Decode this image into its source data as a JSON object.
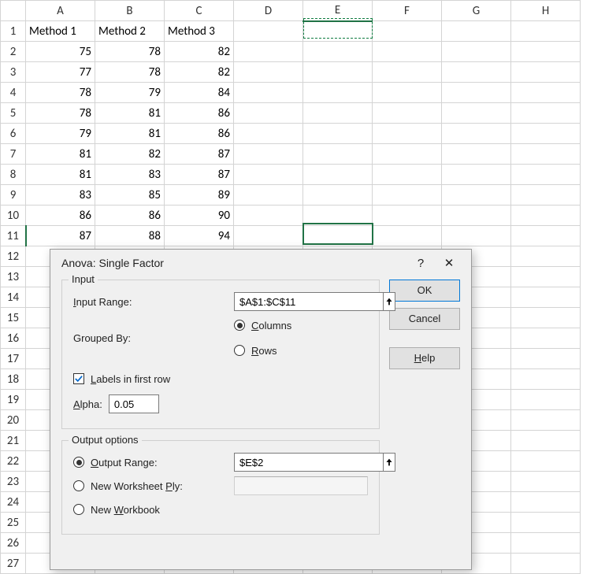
{
  "columns": [
    "A",
    "B",
    "C",
    "D",
    "E",
    "F",
    "G",
    "H"
  ],
  "row_count": 27,
  "headers": [
    "Method 1",
    "Method 2",
    "Method 3"
  ],
  "data": [
    [
      75,
      78,
      82
    ],
    [
      77,
      78,
      82
    ],
    [
      78,
      79,
      84
    ],
    [
      78,
      81,
      86
    ],
    [
      79,
      81,
      86
    ],
    [
      81,
      82,
      87
    ],
    [
      81,
      83,
      87
    ],
    [
      83,
      85,
      89
    ],
    [
      86,
      86,
      90
    ],
    [
      87,
      88,
      94
    ]
  ],
  "marquee_cell": "E2",
  "selected_cell": "E11",
  "dialog": {
    "title": "Anova: Single Factor",
    "help_q": "?",
    "close": "✕",
    "ok": "OK",
    "cancel": "Cancel",
    "help": "Help",
    "input_group": "Input",
    "input_range_label": "Input Range:",
    "input_range_value": "$A$1:$C$11",
    "grouped_by_label": "Grouped By:",
    "opt_columns": "Columns",
    "opt_rows": "Rows",
    "grouped_by_selected": "columns",
    "labels_first_row": "Labels in first row",
    "labels_first_row_checked": true,
    "alpha_label": "Alpha:",
    "alpha_value": "0.05",
    "output_group": "Output options",
    "output_range_label": "Output Range:",
    "output_range_value": "$E$2",
    "new_ws_ply_label": "New Worksheet Ply:",
    "new_wb_label": "New Workbook",
    "output_selected": "range",
    "underlines": {
      "input_range": "I",
      "columns": "C",
      "rows": "R",
      "labels": "L",
      "alpha": "A",
      "output_range": "O",
      "ply": "P",
      "workbook": "W",
      "help": "H"
    }
  }
}
